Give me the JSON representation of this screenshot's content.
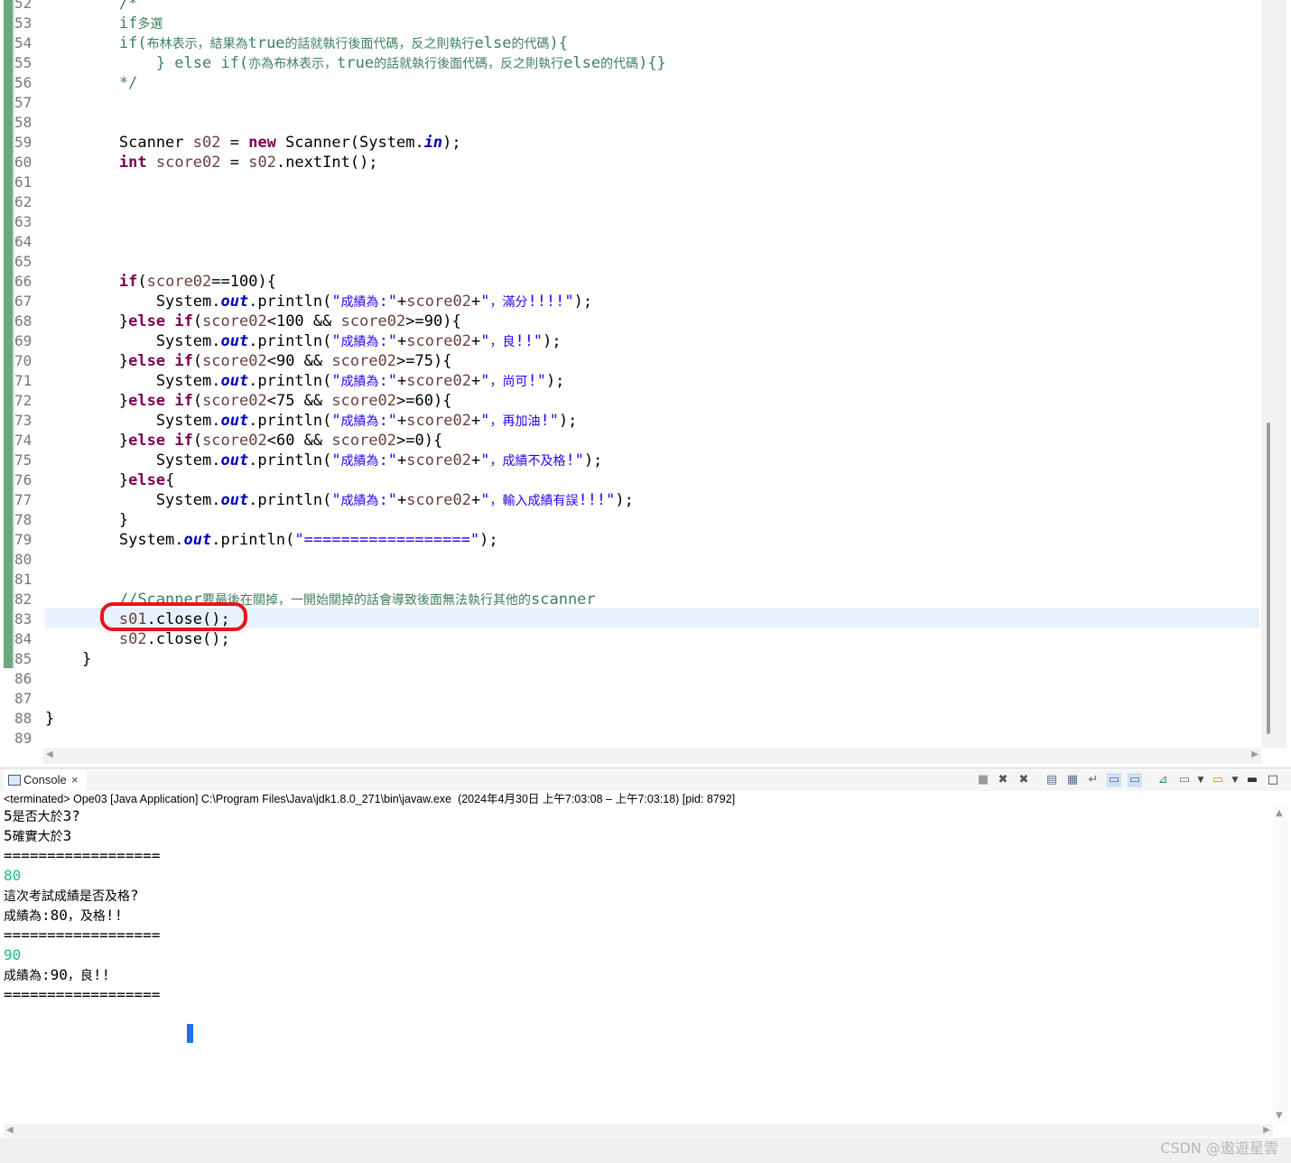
{
  "editor": {
    "lines": [
      {
        "no": "52",
        "segs": [
          {
            "t": "        /*",
            "c": "cm"
          }
        ]
      },
      {
        "no": "53",
        "segs": [
          {
            "t": "        if多選",
            "c": "cm"
          }
        ]
      },
      {
        "no": "54",
        "segs": [
          {
            "t": "        if(布林表示，結果為true的話就執行後面代碼，反之則執行else的代碼){",
            "c": "cm"
          }
        ]
      },
      {
        "no": "55",
        "segs": [
          {
            "t": "            } else if(亦為布林表示，true的話就執行後面代碼，反之則執行else的代碼){}",
            "c": "cm"
          }
        ]
      },
      {
        "no": "56",
        "segs": [
          {
            "t": "        */",
            "c": "cm"
          }
        ]
      },
      {
        "no": "57",
        "segs": []
      },
      {
        "no": "58",
        "segs": []
      },
      {
        "no": "59",
        "segs": [
          {
            "t": "        Scanner ",
            "c": ""
          },
          {
            "t": "s02",
            "c": "var"
          },
          {
            "t": " = ",
            "c": ""
          },
          {
            "t": "new",
            "c": "kw"
          },
          {
            "t": " Scanner(System.",
            "c": ""
          },
          {
            "t": "in",
            "c": "fld"
          },
          {
            "t": ");",
            "c": ""
          }
        ]
      },
      {
        "no": "60",
        "segs": [
          {
            "t": "        ",
            "c": ""
          },
          {
            "t": "int",
            "c": "kw"
          },
          {
            "t": " ",
            "c": ""
          },
          {
            "t": "score02",
            "c": "var"
          },
          {
            "t": " = ",
            "c": ""
          },
          {
            "t": "s02",
            "c": "var"
          },
          {
            "t": ".nextInt();",
            "c": ""
          }
        ]
      },
      {
        "no": "61",
        "segs": []
      },
      {
        "no": "62",
        "segs": []
      },
      {
        "no": "63",
        "segs": []
      },
      {
        "no": "64",
        "segs": []
      },
      {
        "no": "65",
        "segs": []
      },
      {
        "no": "66",
        "segs": [
          {
            "t": "        ",
            "c": ""
          },
          {
            "t": "if",
            "c": "kw"
          },
          {
            "t": "(",
            "c": ""
          },
          {
            "t": "score02",
            "c": "var"
          },
          {
            "t": "==100){",
            "c": ""
          }
        ]
      },
      {
        "no": "67",
        "segs": [
          {
            "t": "            System.",
            "c": ""
          },
          {
            "t": "out",
            "c": "fld"
          },
          {
            "t": ".println(",
            "c": ""
          },
          {
            "t": "\"成績為:\"",
            "c": "st"
          },
          {
            "t": "+",
            "c": ""
          },
          {
            "t": "score02",
            "c": "var"
          },
          {
            "t": "+",
            "c": ""
          },
          {
            "t": "\"，滿分!!!!\"",
            "c": "st"
          },
          {
            "t": ");",
            "c": ""
          }
        ]
      },
      {
        "no": "68",
        "segs": [
          {
            "t": "        }",
            "c": ""
          },
          {
            "t": "else",
            "c": "kw"
          },
          {
            "t": " ",
            "c": ""
          },
          {
            "t": "if",
            "c": "kw"
          },
          {
            "t": "(",
            "c": ""
          },
          {
            "t": "score02",
            "c": "var"
          },
          {
            "t": "<100 && ",
            "c": ""
          },
          {
            "t": "score02",
            "c": "var"
          },
          {
            "t": ">=90){",
            "c": ""
          }
        ]
      },
      {
        "no": "69",
        "segs": [
          {
            "t": "            System.",
            "c": ""
          },
          {
            "t": "out",
            "c": "fld"
          },
          {
            "t": ".println(",
            "c": ""
          },
          {
            "t": "\"成績為:\"",
            "c": "st"
          },
          {
            "t": "+",
            "c": ""
          },
          {
            "t": "score02",
            "c": "var"
          },
          {
            "t": "+",
            "c": ""
          },
          {
            "t": "\"，良!!\"",
            "c": "st"
          },
          {
            "t": ");",
            "c": ""
          }
        ]
      },
      {
        "no": "70",
        "segs": [
          {
            "t": "        }",
            "c": ""
          },
          {
            "t": "else",
            "c": "kw"
          },
          {
            "t": " ",
            "c": ""
          },
          {
            "t": "if",
            "c": "kw"
          },
          {
            "t": "(",
            "c": ""
          },
          {
            "t": "score02",
            "c": "var"
          },
          {
            "t": "<90 && ",
            "c": ""
          },
          {
            "t": "score02",
            "c": "var"
          },
          {
            "t": ">=75){",
            "c": ""
          }
        ]
      },
      {
        "no": "71",
        "segs": [
          {
            "t": "            System.",
            "c": ""
          },
          {
            "t": "out",
            "c": "fld"
          },
          {
            "t": ".println(",
            "c": ""
          },
          {
            "t": "\"成績為:\"",
            "c": "st"
          },
          {
            "t": "+",
            "c": ""
          },
          {
            "t": "score02",
            "c": "var"
          },
          {
            "t": "+",
            "c": ""
          },
          {
            "t": "\"，尚可!\"",
            "c": "st"
          },
          {
            "t": ");",
            "c": ""
          }
        ]
      },
      {
        "no": "72",
        "segs": [
          {
            "t": "        }",
            "c": ""
          },
          {
            "t": "else",
            "c": "kw"
          },
          {
            "t": " ",
            "c": ""
          },
          {
            "t": "if",
            "c": "kw"
          },
          {
            "t": "(",
            "c": ""
          },
          {
            "t": "score02",
            "c": "var"
          },
          {
            "t": "<75 && ",
            "c": ""
          },
          {
            "t": "score02",
            "c": "var"
          },
          {
            "t": ">=60){",
            "c": ""
          }
        ]
      },
      {
        "no": "73",
        "segs": [
          {
            "t": "            System.",
            "c": ""
          },
          {
            "t": "out",
            "c": "fld"
          },
          {
            "t": ".println(",
            "c": ""
          },
          {
            "t": "\"成績為:\"",
            "c": "st"
          },
          {
            "t": "+",
            "c": ""
          },
          {
            "t": "score02",
            "c": "var"
          },
          {
            "t": "+",
            "c": ""
          },
          {
            "t": "\"，再加油!\"",
            "c": "st"
          },
          {
            "t": ");",
            "c": ""
          }
        ]
      },
      {
        "no": "74",
        "segs": [
          {
            "t": "        }",
            "c": ""
          },
          {
            "t": "else",
            "c": "kw"
          },
          {
            "t": " ",
            "c": ""
          },
          {
            "t": "if",
            "c": "kw"
          },
          {
            "t": "(",
            "c": ""
          },
          {
            "t": "score02",
            "c": "var"
          },
          {
            "t": "<60 && ",
            "c": ""
          },
          {
            "t": "score02",
            "c": "var"
          },
          {
            "t": ">=0){",
            "c": ""
          }
        ]
      },
      {
        "no": "75",
        "segs": [
          {
            "t": "            System.",
            "c": ""
          },
          {
            "t": "out",
            "c": "fld"
          },
          {
            "t": ".println(",
            "c": ""
          },
          {
            "t": "\"成績為:\"",
            "c": "st"
          },
          {
            "t": "+",
            "c": ""
          },
          {
            "t": "score02",
            "c": "var"
          },
          {
            "t": "+",
            "c": ""
          },
          {
            "t": "\"，成績不及格!\"",
            "c": "st"
          },
          {
            "t": ");",
            "c": ""
          }
        ]
      },
      {
        "no": "76",
        "segs": [
          {
            "t": "        }",
            "c": ""
          },
          {
            "t": "else",
            "c": "kw"
          },
          {
            "t": "{",
            "c": ""
          }
        ]
      },
      {
        "no": "77",
        "segs": [
          {
            "t": "            System.",
            "c": ""
          },
          {
            "t": "out",
            "c": "fld"
          },
          {
            "t": ".println(",
            "c": ""
          },
          {
            "t": "\"成績為:\"",
            "c": "st"
          },
          {
            "t": "+",
            "c": ""
          },
          {
            "t": "score02",
            "c": "var"
          },
          {
            "t": "+",
            "c": ""
          },
          {
            "t": "\"，輸入成績有誤!!!\"",
            "c": "st"
          },
          {
            "t": ");",
            "c": ""
          }
        ]
      },
      {
        "no": "78",
        "segs": [
          {
            "t": "        }",
            "c": ""
          }
        ]
      },
      {
        "no": "79",
        "segs": [
          {
            "t": "        System.",
            "c": ""
          },
          {
            "t": "out",
            "c": "fld"
          },
          {
            "t": ".println(",
            "c": ""
          },
          {
            "t": "\"==================\"",
            "c": "st"
          },
          {
            "t": ");",
            "c": ""
          }
        ]
      },
      {
        "no": "80",
        "segs": []
      },
      {
        "no": "81",
        "segs": []
      },
      {
        "no": "82",
        "segs": [
          {
            "t": "        //Scanner要最後在關掉，一開始關掉的話會導致後面無法執行其他的scanner",
            "c": "cm"
          }
        ]
      },
      {
        "no": "83",
        "segs": [
          {
            "t": "        ",
            "c": ""
          },
          {
            "t": "s01",
            "c": "var"
          },
          {
            "t": ".close();",
            "c": ""
          }
        ]
      },
      {
        "no": "84",
        "segs": [
          {
            "t": "        ",
            "c": ""
          },
          {
            "t": "s02",
            "c": "var"
          },
          {
            "t": ".close();",
            "c": ""
          }
        ]
      },
      {
        "no": "85",
        "segs": [
          {
            "t": "    }",
            "c": ""
          }
        ]
      },
      {
        "no": "86",
        "segs": []
      },
      {
        "no": "87",
        "segs": []
      },
      {
        "no": "88",
        "segs": [
          {
            "t": "}",
            "c": ""
          }
        ]
      },
      {
        "no": "89",
        "segs": []
      }
    ]
  },
  "console": {
    "tab_label": "Console",
    "tab_close": "×",
    "status": "<terminated> Ope03 [Java Application] C:\\Program Files\\Java\\jdk1.8.0_271\\bin\\javaw.exe  (2024年4月30日 上午7:03:08 – 上午7:03:18) [pid: 8792]",
    "output": [
      {
        "t": "5是否大於3?",
        "input": false
      },
      {
        "t": "5確實大於3",
        "input": false
      },
      {
        "t": "==================",
        "input": false
      },
      {
        "t": "80",
        "input": true
      },
      {
        "t": "這次考試成績是否及格?",
        "input": false
      },
      {
        "t": "成績為:80，及格!!",
        "input": false
      },
      {
        "t": "==================",
        "input": false
      },
      {
        "t": "90",
        "input": true
      },
      {
        "t": "成績為:90，良!!",
        "input": false
      },
      {
        "t": "==================",
        "input": false
      }
    ],
    "toolbar_icons": [
      "terminate-icon",
      "remove-launch-icon",
      "remove-all-terminated-icon",
      "clear-console-icon",
      "scroll-lock-icon",
      "word-wrap-icon",
      "show-on-stdout-icon",
      "show-on-stderr-icon",
      "pin-console-icon",
      "display-selected-console-icon",
      "open-console-icon",
      "minimize-icon",
      "maximize-icon"
    ]
  },
  "watermark": "CSDN @遨遊星雲",
  "colors": {
    "keyword": "#7f0055",
    "string": "#2a00ff",
    "comment": "#3f7f5f",
    "field": "#0000c0",
    "variable": "#6a3e3e",
    "input_text": "#1eb980",
    "highlight_ring": "#e8141b",
    "current_line": "#e8f2fe"
  }
}
